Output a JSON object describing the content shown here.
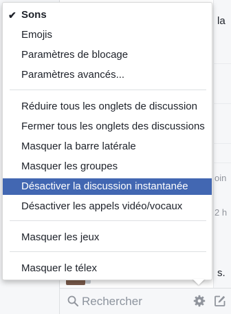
{
  "background": {
    "snippets": [
      {
        "text": "la"
      },
      {
        "text": "oin"
      },
      {
        "text": "2 h"
      },
      {
        "text": "s."
      }
    ]
  },
  "menu": {
    "items": [
      {
        "label": "Sons",
        "checked": true
      },
      {
        "label": "Emojis"
      },
      {
        "label": "Paramètres de blocage"
      },
      {
        "label": "Paramètres avancés..."
      },
      {
        "label": "Réduire tous les onglets de discussion"
      },
      {
        "label": "Fermer tous les onglets des discussions"
      },
      {
        "label": "Masquer la barre latérale"
      },
      {
        "label": "Masquer les groupes"
      },
      {
        "label": "Désactiver la discussion instantanée",
        "highlighted": true
      },
      {
        "label": "Désactiver les appels vidéo/vocaux"
      },
      {
        "label": "Masquer les jeux"
      },
      {
        "label": "Masquer le télex"
      }
    ]
  },
  "search": {
    "placeholder": "Rechercher"
  },
  "icons": {
    "check": "check-icon",
    "search": "search-icon",
    "gear": "gear-icon",
    "compose": "compose-icon"
  },
  "colors": {
    "highlight": "#4267b2",
    "menu_text": "#1d2129",
    "separator": "#dddfe2",
    "icon_gray": "#90949c"
  }
}
